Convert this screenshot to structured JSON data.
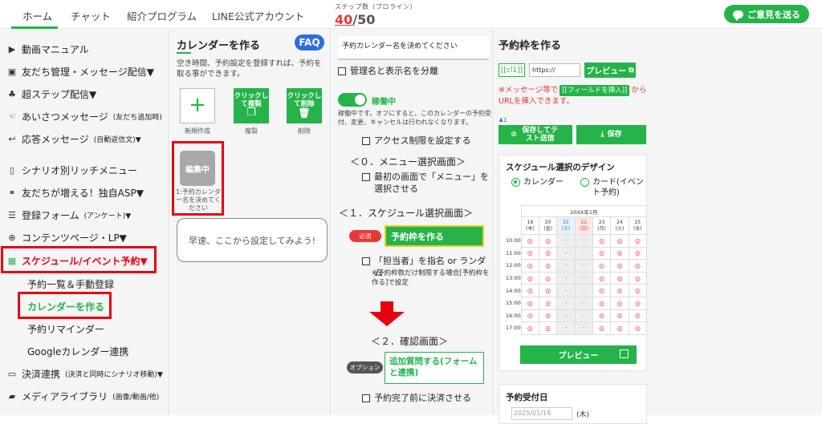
{
  "nav": {
    "tabs": [
      "ホーム",
      "チャット",
      "紹介プログラム",
      "LINE公式アカウント"
    ],
    "steps_label": "ステップ数（プロライン）",
    "steps_used": "40",
    "steps_sep": "/",
    "steps_total": "50",
    "feedback": "ご意見を送る"
  },
  "sidebar": {
    "items": [
      {
        "label": "動画マニュアル",
        "icon": "video-icon"
      },
      {
        "label": "友だち管理・メッセージ配信▼",
        "icon": "contact-icon"
      },
      {
        "label": "超ステップ配信▼",
        "icon": "org-chart-icon"
      },
      {
        "label": "あいさつメッセージ",
        "small": "(友だち追加時)",
        "icon": "hand-icon"
      },
      {
        "label": "応答メッセージ",
        "small": "(自動返信文)▼",
        "icon": "reply-icon"
      },
      {
        "label": "シナリオ別リッチメニュー",
        "icon": "phone-icon"
      },
      {
        "label": "友だちが増える！独自ASP▼",
        "icon": "handshake-icon"
      },
      {
        "label": "登録フォーム",
        "small": "(アンケート)▼",
        "icon": "list-icon"
      },
      {
        "label": "コンテンツページ・LP▼",
        "icon": "globe-icon"
      },
      {
        "label": "スケジュール/イベント予約▼",
        "icon": "calendar-icon"
      },
      {
        "label": "決済連携",
        "small": "(決済と同時にシナリオ移動)▼",
        "icon": "card-icon"
      },
      {
        "label": "メディアライブラリ",
        "small": "(画像/動画/他)",
        "icon": "folder-icon"
      }
    ],
    "subitems": [
      "予約一覧＆手動登録",
      "カレンダーを作る",
      "予約リマインダー",
      "Googleカレンダー連携"
    ]
  },
  "calendar_panel": {
    "title": "カレンダーを作る",
    "faq": "FAQ",
    "description": "空き時間、予約設定を登録すれば、予約を取る事ができます。",
    "new_label": "新規作成",
    "copy_button": "クリックして複製",
    "copy_label": "複製",
    "delete_button": "クリックして削除",
    "delete_label": "削除",
    "editing_badge": "編集中",
    "calendar_caption": "1:予約カレンダー名を決めてください",
    "tooltip": "早速、ここから設定してみよう!"
  },
  "settings": {
    "name_title": "予約カレンダー名を決めてください",
    "separate_names": "管理名と表示名を分離",
    "status": "稼働中",
    "status_desc": "稼働中です。オフにすると、このカレンダーの予約受付、変更、キャンセルは行われなくなります。",
    "access_limit": "アクセス制限を設定する",
    "section0": "＜０．メニュー選択画面＞",
    "menu_first": "最初の画面で「メニュー」を選択させる",
    "section1": "＜１．スケジュール選択画面＞",
    "required": "必須",
    "slot_button": "予約枠を作る",
    "assign_staff": "「担当者」を指名 or ランダム",
    "staff_note": "※予約枠数だけ制限する場合[予約枠を作る]で設定",
    "section2": "＜２．確認画面＞",
    "option": "オプション",
    "extra_question": "追加質問する(フォームと連携)",
    "pay_before": "予約完了前に決済させる"
  },
  "slot_panel": {
    "title": "予約枠を作る",
    "tag": "[[cl1]]",
    "url": "https://",
    "preview": "プレビュー",
    "note_pre": "※メッセージ等で",
    "note_field": "[[フィールドを挿入]]",
    "note_post": "からURLを挿入できます。",
    "person_count": "1",
    "save_test": "保存してテスト送信",
    "save": "保存",
    "design_title": "スケジュール選択のデザイン",
    "opt_calendar": "カレンダー",
    "opt_card": "カード(イベント予約)",
    "month": "20XX年1月",
    "days": [
      {
        "d": "19",
        "w": "(木)",
        "type": ""
      },
      {
        "d": "20",
        "w": "(金)",
        "type": ""
      },
      {
        "d": "21",
        "w": "(土)",
        "type": "sat"
      },
      {
        "d": "22",
        "w": "(日)",
        "type": "sun"
      },
      {
        "d": "23",
        "w": "(月)",
        "type": ""
      },
      {
        "d": "24",
        "w": "(火)",
        "type": ""
      },
      {
        "d": "25",
        "w": "(水)",
        "type": ""
      }
    ],
    "times": [
      "10:00",
      "11:00",
      "12:00",
      "13:00",
      "14:00",
      "15:00",
      "16:00",
      "17:00"
    ],
    "available": "◎",
    "unavailable": "-",
    "calendar_preview": "プレビュー",
    "accept_title": "予約受付日",
    "date_placeholder": "2025/01/19",
    "date_weekday": "(木)"
  },
  "colors": {
    "accent": "#25b34a",
    "highlight": "#e60012",
    "faq": "#2e6edc"
  }
}
